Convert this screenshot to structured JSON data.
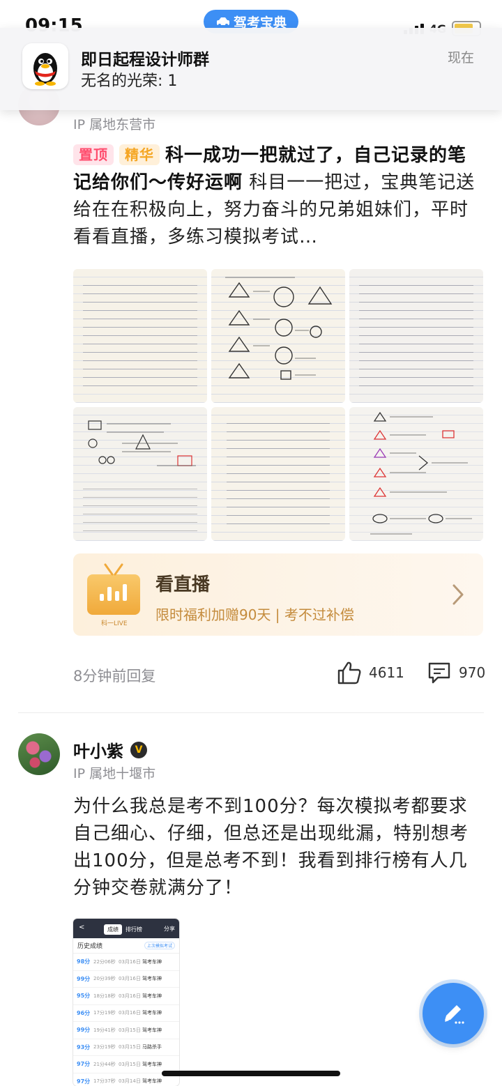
{
  "status_bar": {
    "time": "09:15",
    "app_pill": "驾考宝典",
    "network": "4G"
  },
  "notification": {
    "app": "QQ",
    "title": "即日起程设计师群",
    "message": "无名的光荣: 1",
    "time": "现在"
  },
  "post1": {
    "location": "IP 属地东营市",
    "tag_top": "置顶",
    "tag_best": "精华",
    "title": "科一成功一把就过了，自己记录的笔记给你们～传好运啊",
    "body": " 科目一一把过，宝典笔记送给在在积极向上，努力奋斗的兄弟姐妹们，平时看看直播，多练习模拟考试…",
    "image_count": 6,
    "live_card": {
      "title": "看直播",
      "subtitle": "限时福利加赠90天 | 考不过补偿",
      "tv_label": "科一LIVE"
    },
    "time_ago": "8分钟前回复",
    "likes": "4611",
    "comments": "970"
  },
  "post2": {
    "author": "叶小紫",
    "badge": "V",
    "location": "IP 属地十堰市",
    "body": "为什么我总是考不到100分？每次模拟考都要求自己细心、仔细，但总还是出现纰漏，特别想考出100分，但是总考不到！我看到排行榜有人几分钟交卷就满分了！",
    "screenshot": {
      "back": "<",
      "tabs": [
        "成绩",
        "排行榜"
      ],
      "share": "分享",
      "header": "历史成绩",
      "header_action": "上次模拟考试",
      "rows": [
        {
          "score": "98分",
          "time": "22分06秒",
          "date": "03月16日",
          "type": "驾考车神"
        },
        {
          "score": "99分",
          "time": "20分39秒",
          "date": "03月16日",
          "type": "驾考车神"
        },
        {
          "score": "95分",
          "time": "18分18秒",
          "date": "03月16日",
          "type": "驾考车神"
        },
        {
          "score": "96分",
          "time": "17分19秒",
          "date": "03月16日",
          "type": "驾考车神"
        },
        {
          "score": "99分",
          "time": "19分41秒",
          "date": "03月15日",
          "type": "驾考车神"
        },
        {
          "score": "93分",
          "time": "23分19秒",
          "date": "03月15日",
          "type": "马路杀手"
        },
        {
          "score": "97分",
          "time": "21分44秒",
          "date": "03月15日",
          "type": "驾考车神"
        },
        {
          "score": "97分",
          "time": "17分37秒",
          "date": "03月14日",
          "type": "驾考车神"
        }
      ]
    }
  },
  "colors": {
    "accent": "#3d8ff5",
    "tag_top": "#ff4d6d",
    "tag_best": "#f5a623",
    "live_bg": "#fdf0dc"
  }
}
